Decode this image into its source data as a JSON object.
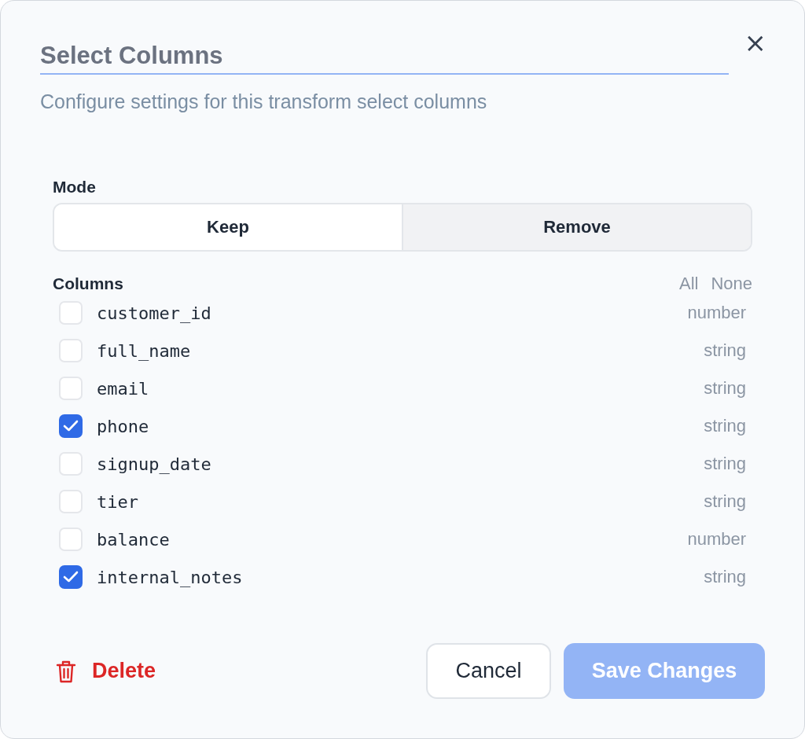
{
  "dialog": {
    "title": "Select Columns",
    "subtitle": "Configure settings for this transform select columns",
    "close": "×"
  },
  "mode": {
    "label": "Mode",
    "options": [
      {
        "label": "Keep",
        "selected": true
      },
      {
        "label": "Remove",
        "selected": false
      }
    ]
  },
  "columns": {
    "label": "Columns",
    "all": "All",
    "none": "None",
    "items": [
      {
        "name": "customer_id",
        "type": "number",
        "checked": false
      },
      {
        "name": "full_name",
        "type": "string",
        "checked": false
      },
      {
        "name": "email",
        "type": "string",
        "checked": false
      },
      {
        "name": "phone",
        "type": "string",
        "checked": true
      },
      {
        "name": "signup_date",
        "type": "string",
        "checked": false
      },
      {
        "name": "tier",
        "type": "string",
        "checked": false
      },
      {
        "name": "balance",
        "type": "number",
        "checked": false
      },
      {
        "name": "internal_notes",
        "type": "string",
        "checked": true
      }
    ]
  },
  "footer": {
    "delete": "Delete",
    "cancel": "Cancel",
    "save": {
      "label": "Save Changes",
      "disabled": true
    }
  }
}
